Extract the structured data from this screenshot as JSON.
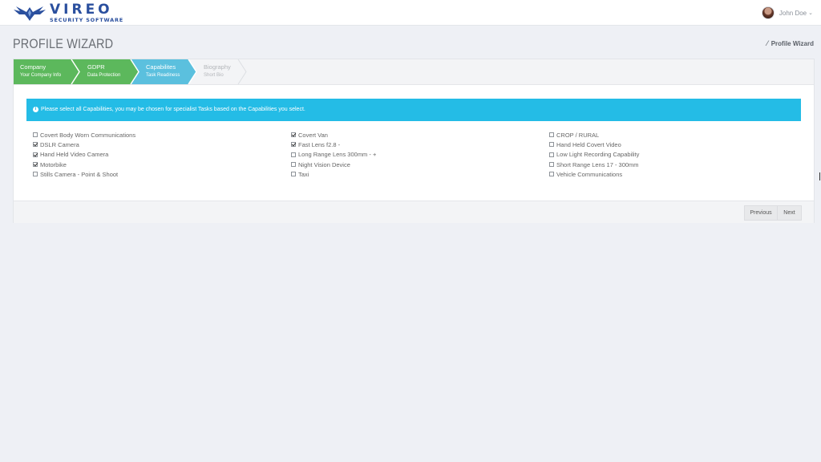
{
  "header": {
    "logo_name": "VIREO",
    "logo_sub": "SECURITY SOFTWARE",
    "user_name": "John Doe"
  },
  "page": {
    "title": "PROFILE WIZARD",
    "breadcrumb": "Profile Wizard"
  },
  "steps": [
    {
      "title": "Company",
      "subtitle": "Your Company Info",
      "state": "done"
    },
    {
      "title": "GDPR",
      "subtitle": "Data Protection",
      "state": "done"
    },
    {
      "title": "Capabilites",
      "subtitle": "Task Readiness",
      "state": "active"
    },
    {
      "title": "Biography",
      "subtitle": "Short Bio",
      "state": "todo"
    }
  ],
  "alert": "Please select all Capabilities, you may be chosen for specialist Tasks based on the Capabilities you select.",
  "capabilities": {
    "col1": [
      {
        "label": "Covert Body Worn Communications",
        "checked": false
      },
      {
        "label": "DSLR Camera",
        "checked": true
      },
      {
        "label": "Hand Held Video Camera",
        "checked": true
      },
      {
        "label": "Motorbike",
        "checked": true
      },
      {
        "label": "Stills Camera - Point & Shoot",
        "checked": false
      }
    ],
    "col2": [
      {
        "label": "Covert Van",
        "checked": true
      },
      {
        "label": "Fast Lens f2.8 -",
        "checked": true
      },
      {
        "label": "Long Range Lens 300mm - +",
        "checked": false
      },
      {
        "label": "Night Vision Device",
        "checked": false
      },
      {
        "label": "Taxi",
        "checked": false
      }
    ],
    "col3": [
      {
        "label": "CROP / RURAL",
        "checked": false
      },
      {
        "label": "Hand Held Covert Video",
        "checked": false
      },
      {
        "label": "Low Light Recording Capability",
        "checked": false
      },
      {
        "label": "Short Range Lens 17 - 300mm",
        "checked": false
      },
      {
        "label": "Vehicle Communications",
        "checked": false
      }
    ]
  },
  "buttons": {
    "previous": "Previous",
    "next": "Next"
  },
  "colors": {
    "step_done": "#5cb85c",
    "step_active": "#5bc0de",
    "alert": "#24bce6",
    "brand": "#2a4f9e"
  }
}
